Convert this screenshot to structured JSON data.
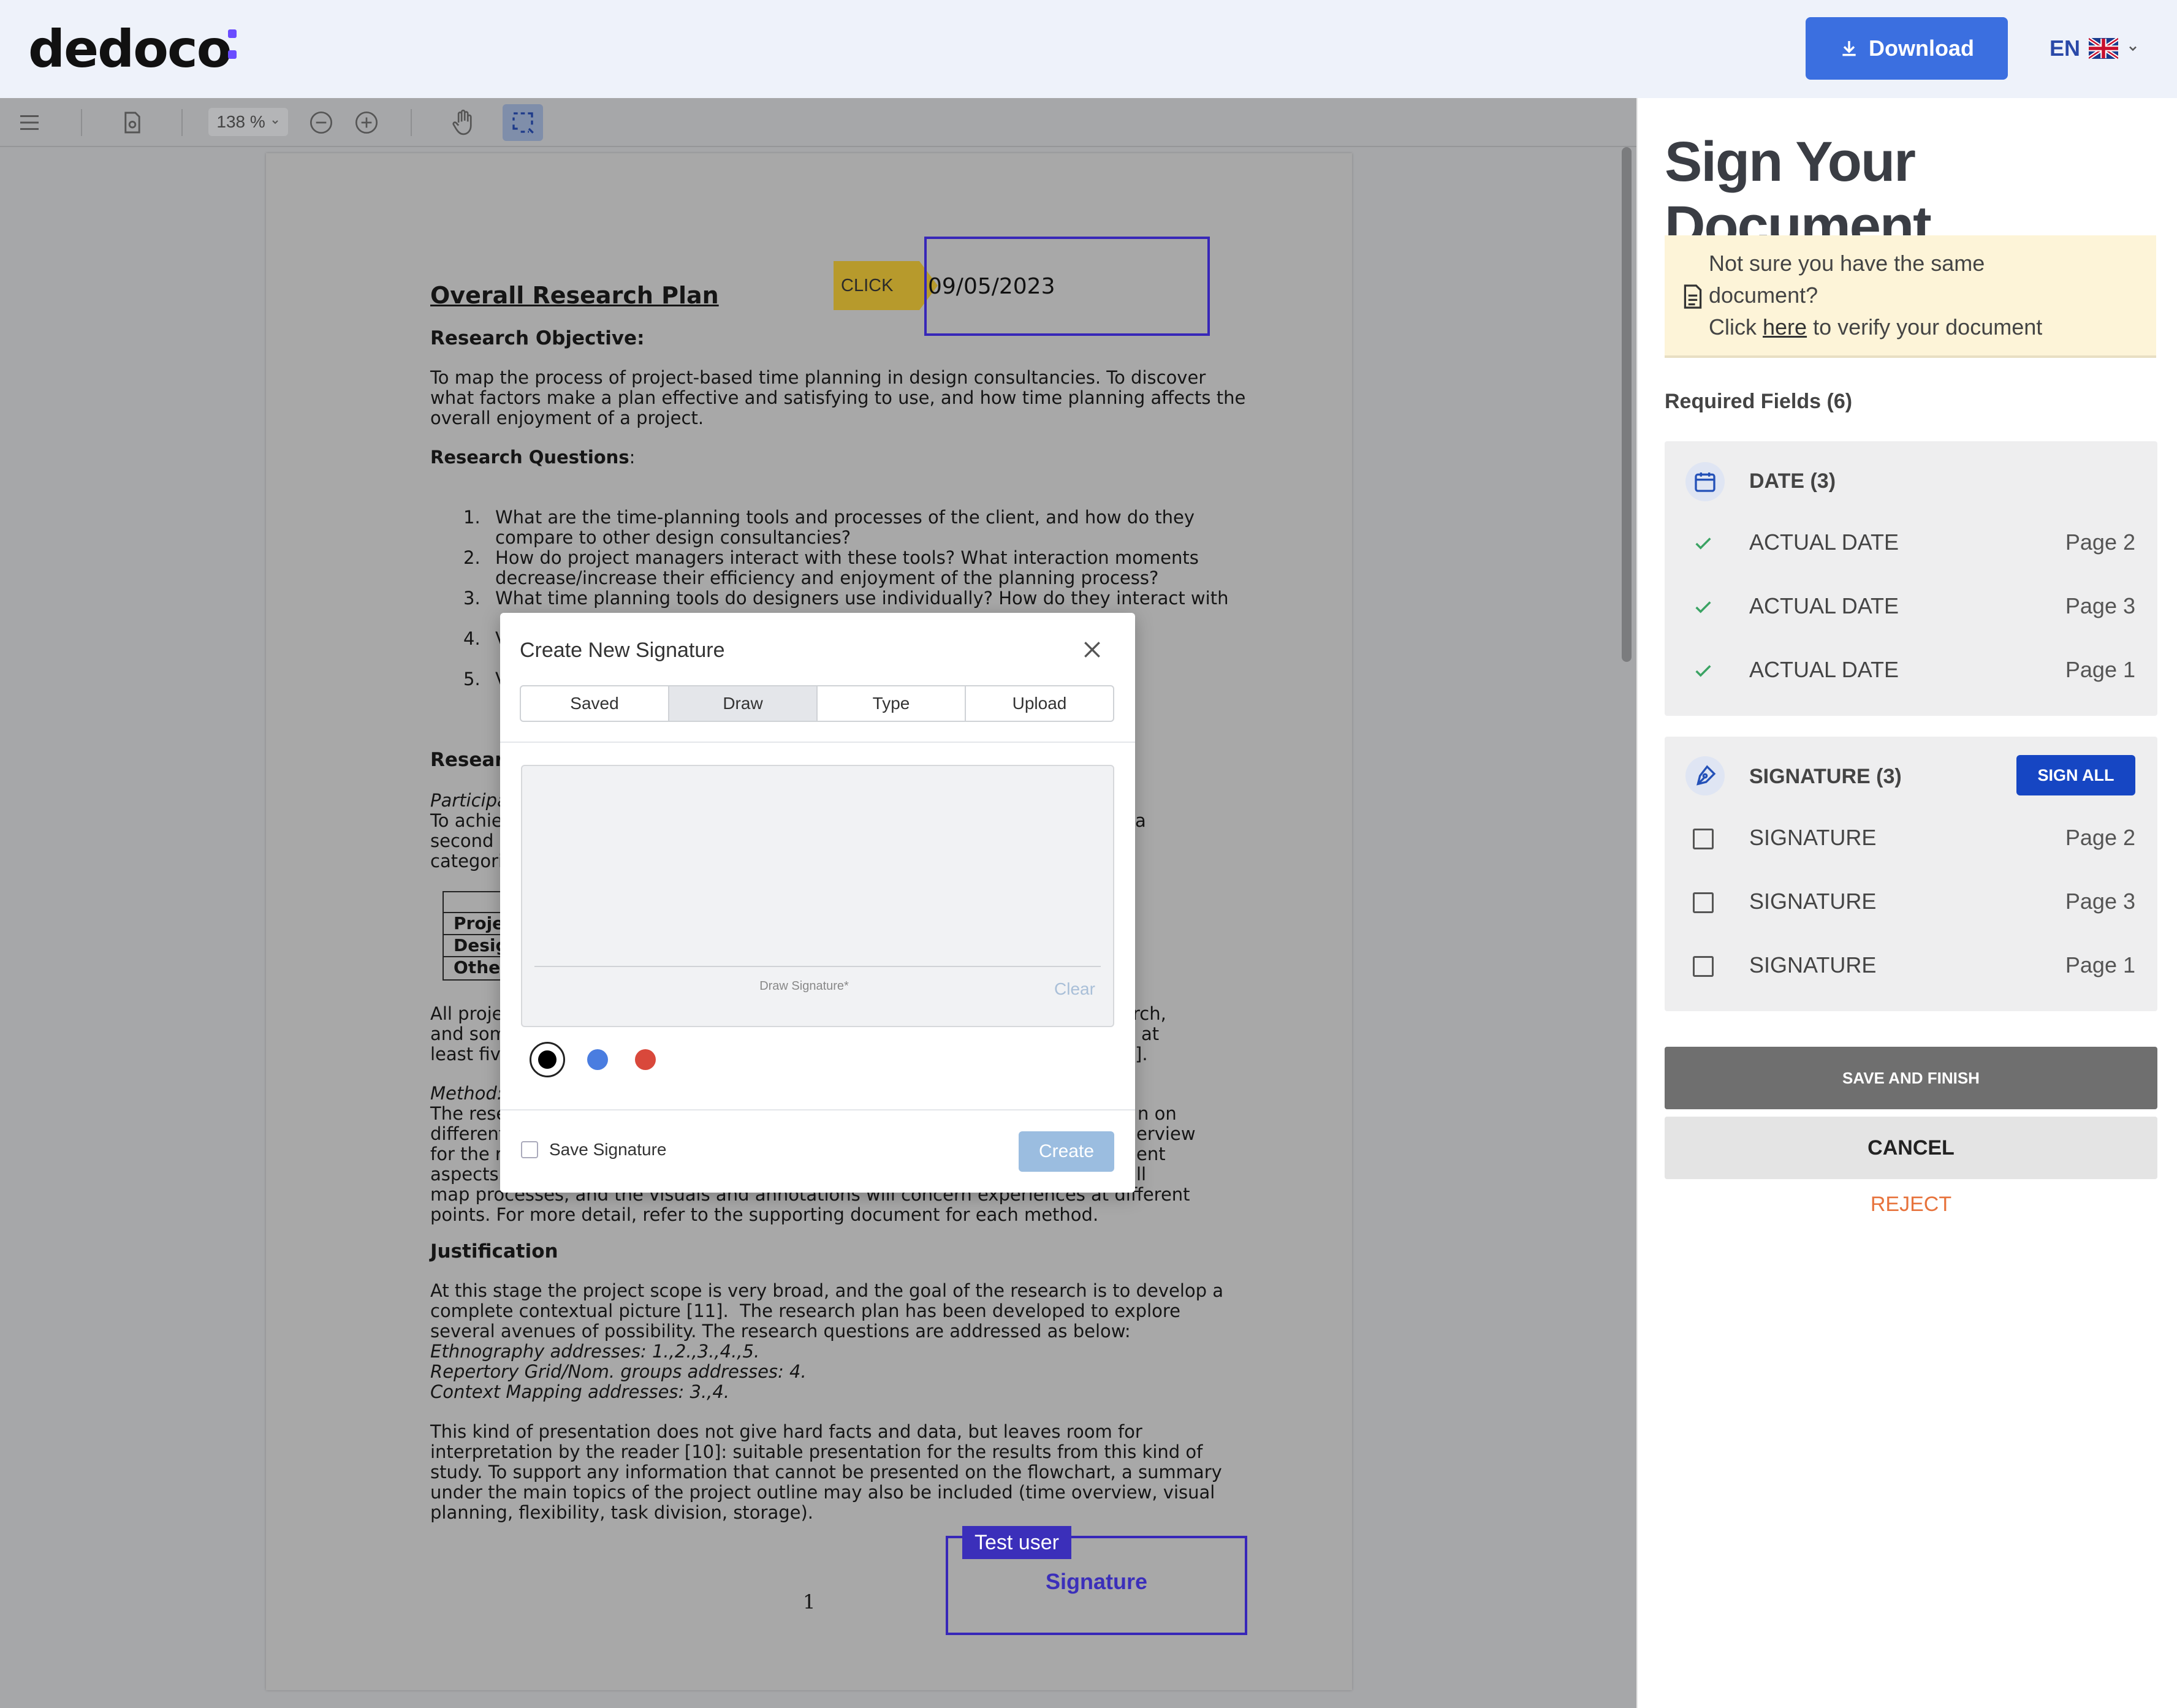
{
  "header": {
    "logo": "dedoco",
    "download_label": "Download",
    "language": "EN"
  },
  "viewer": {
    "zoom": "138 %",
    "page": {
      "title": "Overall Research Plan",
      "objective_heading": "Research Objective:",
      "objective_text": [
        "To map the process of project-based time planning in design consultancies. To discover",
        "what factors make a plan effective and satisfying to use, and how time planning affects the",
        "overall enjoyment of a project."
      ],
      "questions_heading": "Research Questions",
      "questions_colon": ":",
      "questions": [
        {
          "num": "1.",
          "lines": [
            "What are the time-planning tools and processes of the client, and how do they",
            "compare to other design consultancies?"
          ]
        },
        {
          "num": "2.",
          "lines": [
            "How do project managers interact with these tools? What interaction moments",
            "decrease/increase their efficiency and enjoyment of the planning process?"
          ]
        },
        {
          "num": "3.",
          "lines": [
            "What time planning tools do designers use individually? How do they interact with"
          ]
        },
        {
          "num": "4.",
          "lines": [
            "V"
          ]
        },
        {
          "num": "5.",
          "lines": [
            "V"
          ]
        }
      ],
      "left_fragments": {
        "research": "Resear",
        "participa": "Participa",
        "to_achie": "To achie",
        "second": "second o",
        "categori": "categori",
        "right_a": "a",
        "table": [
          "Proje",
          "Desig",
          "Othe"
        ],
        "all_proje": "All proje",
        "and_som": "and som",
        "least_five": "least five",
        "right_rch": "rch,",
        "right_at": "at",
        "right_dot": "].",
        "method": "Method:",
        "the_rese": "The rese",
        "different": "different",
        "for_the": "for the r",
        "aspects": "aspects",
        "right_on": "n on",
        "right_erview": "erview",
        "right_ent": "ent",
        "right_ll": "ll"
      },
      "method_tail": [
        "map processes, and the visuals and annotations will concern experiences at different",
        "points. For more detail, refer to the supporting document for each method."
      ],
      "justification_heading": "Justification",
      "justification_text": [
        "At this stage the project scope is very broad, and the goal of the research is to develop a",
        "complete contextual picture [11].  The research plan has been developed to explore",
        "several avenues of possibility. The research questions are addressed as below:"
      ],
      "justification_italic": [
        "Ethnography addresses: 1.,2.,3.,4.,5.",
        "Repertory Grid/Nom. groups addresses: 4.",
        "Context Mapping addresses: 3.,4."
      ],
      "presentation_text": [
        "This kind of presentation does not give hard facts and data, but leaves room for",
        "interpretation by the reader [10]: suitable presentation for the results from this kind of",
        "study. To support any information that cannot be presented on the flowchart, a summary",
        "under the main topics of the project outline may also be included (time overview, visual",
        "planning, flexibility, task division, storage)."
      ],
      "page_number": "1",
      "date_value": "09/05/2023",
      "click_tag": "CLICK",
      "signature_user": "Test user",
      "signature_label": "Signature"
    }
  },
  "modal": {
    "title": "Create New Signature",
    "tabs": [
      "Saved",
      "Draw",
      "Type",
      "Upload"
    ],
    "active_tab": "Draw",
    "draw_hint": "Draw Signature*",
    "clear_label": "Clear",
    "colors": [
      "#000000",
      "#4a7de0",
      "#d9483b"
    ],
    "selected_color": "#000000",
    "save_signature_label": "Save Signature",
    "create_label": "Create"
  },
  "sidebar": {
    "title": "Sign Your Document",
    "notice_line1": "Not sure you have the same",
    "notice_line2": "document?",
    "notice_click": "Click",
    "notice_here": "here",
    "notice_rest": "to verify your document",
    "required_title": "Required Fields (6)",
    "date_group": {
      "title": "DATE (3)",
      "items": [
        {
          "label": "ACTUAL DATE",
          "page": "Page 2"
        },
        {
          "label": "ACTUAL DATE",
          "page": "Page 3"
        },
        {
          "label": "ACTUAL DATE",
          "page": "Page 1"
        }
      ]
    },
    "signature_group": {
      "title": "SIGNATURE (3)",
      "sign_all": "SIGN ALL",
      "items": [
        {
          "label": "SIGNATURE",
          "page": "Page 2"
        },
        {
          "label": "SIGNATURE",
          "page": "Page 3"
        },
        {
          "label": "SIGNATURE",
          "page": "Page 1"
        }
      ]
    },
    "save_finish": "SAVE AND FINISH",
    "cancel": "CANCEL",
    "reject": "REJECT"
  }
}
